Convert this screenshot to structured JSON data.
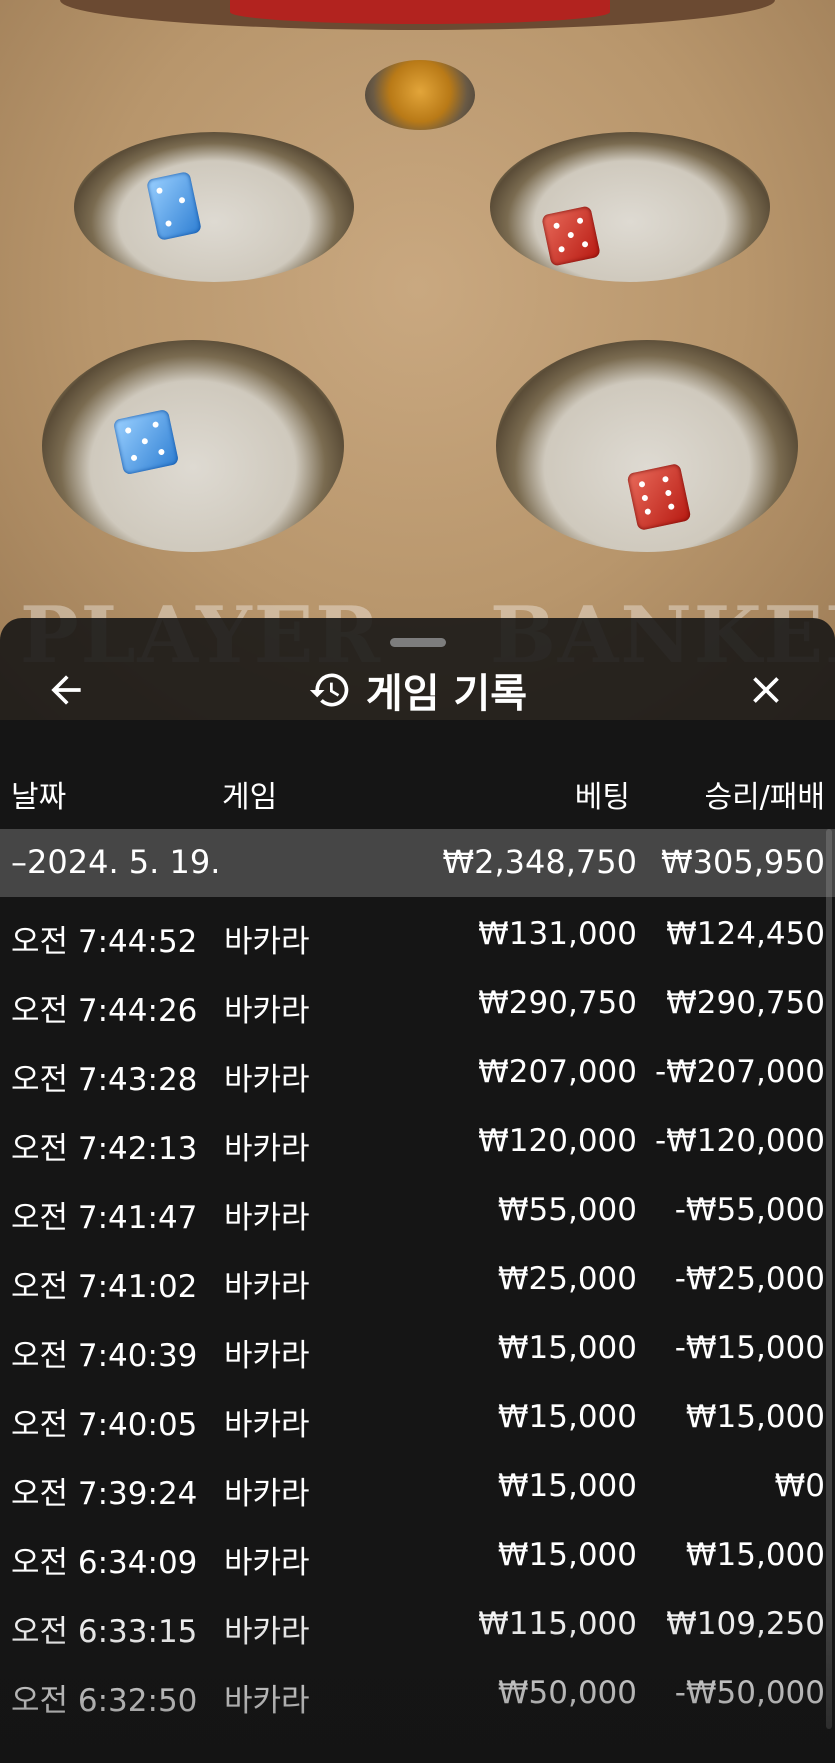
{
  "background": {
    "player_text": "PLAYER",
    "banker_text": "BANKER"
  },
  "header": {
    "title": "게임 기록",
    "back_icon": "arrow-left-icon",
    "history_icon": "history-clock-icon",
    "close_icon": "close-icon"
  },
  "columns": {
    "date": "날짜",
    "game": "게임",
    "bet": "베팅",
    "win_loss": "승리/패배"
  },
  "date_group": {
    "date": "–2024. 5. 19.",
    "total_bet": "₩2,348,750",
    "total_win_loss": "₩305,950"
  },
  "rows": [
    {
      "time": "오전 7:44:52",
      "game": "바카라",
      "bet": "₩131,000",
      "result": "₩124,450"
    },
    {
      "time": "오전 7:44:26",
      "game": "바카라",
      "bet": "₩290,750",
      "result": "₩290,750"
    },
    {
      "time": "오전 7:43:28",
      "game": "바카라",
      "bet": "₩207,000",
      "result": "-₩207,000"
    },
    {
      "time": "오전 7:42:13",
      "game": "바카라",
      "bet": "₩120,000",
      "result": "-₩120,000"
    },
    {
      "time": "오전 7:41:47",
      "game": "바카라",
      "bet": "₩55,000",
      "result": "-₩55,000"
    },
    {
      "time": "오전 7:41:02",
      "game": "바카라",
      "bet": "₩25,000",
      "result": "-₩25,000"
    },
    {
      "time": "오전 7:40:39",
      "game": "바카라",
      "bet": "₩15,000",
      "result": "-₩15,000"
    },
    {
      "time": "오전 7:40:05",
      "game": "바카라",
      "bet": "₩15,000",
      "result": "₩15,000"
    },
    {
      "time": "오전 7:39:24",
      "game": "바카라",
      "bet": "₩15,000",
      "result": "₩0"
    },
    {
      "time": "오전 6:34:09",
      "game": "바카라",
      "bet": "₩15,000",
      "result": "₩15,000"
    },
    {
      "time": "오전 6:33:15",
      "game": "바카라",
      "bet": "₩115,000",
      "result": "₩109,250"
    },
    {
      "time": "오전 6:32:50",
      "game": "바카라",
      "bet": "₩50,000",
      "result": "-₩50,000"
    }
  ]
}
